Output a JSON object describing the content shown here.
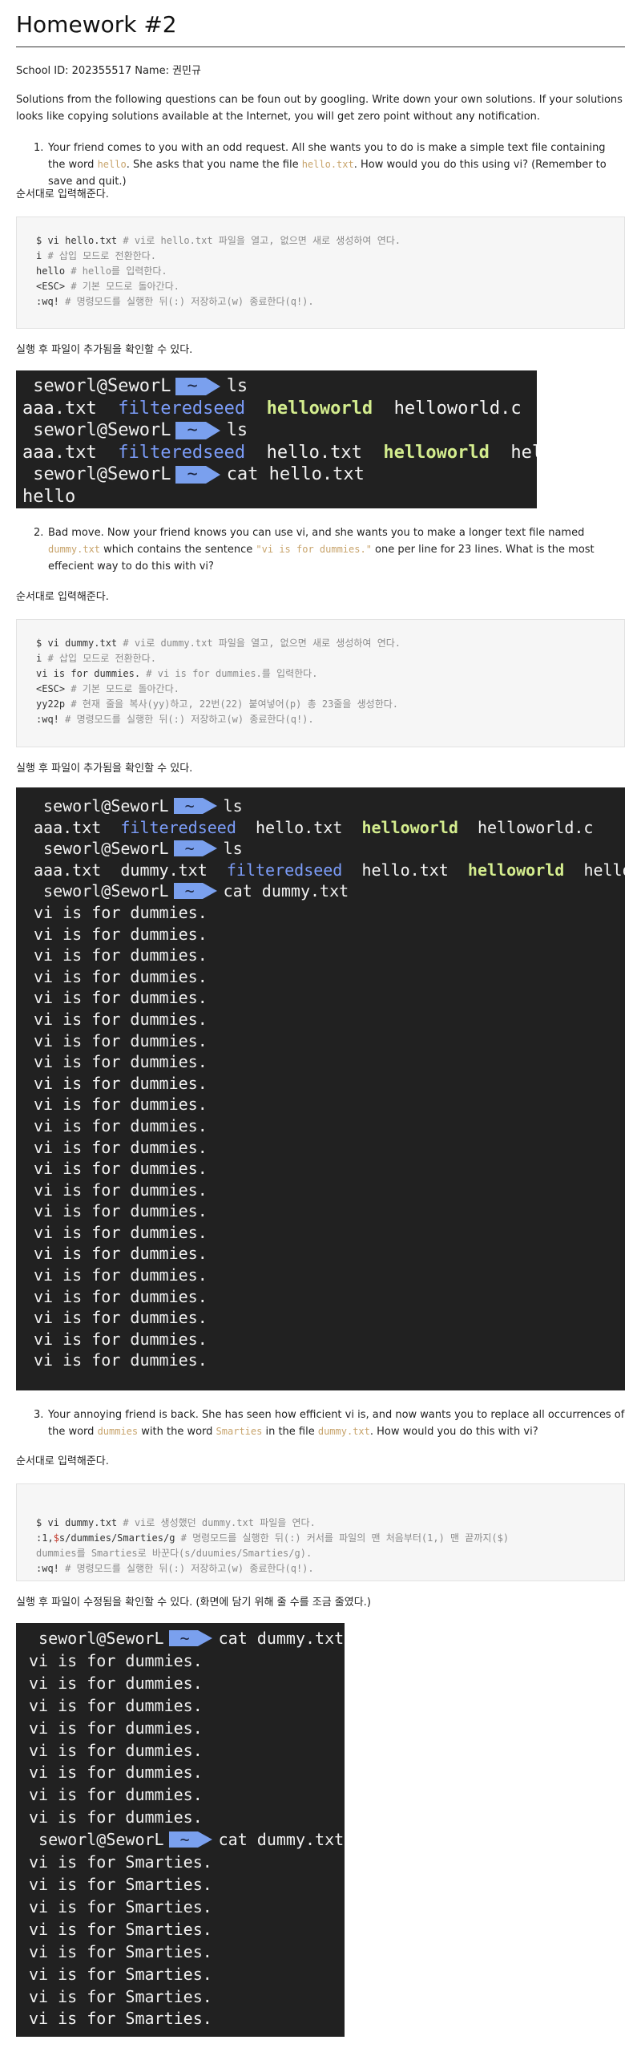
{
  "title": "Homework #2",
  "school_line": "School ID: 202355517 Name: 권민규",
  "intro": "Solutions from the following questions can be foun out by googling. Write down your own solutions. If your solutions looks like copying solutions available at the Internet, you will get zero point without any notification.",
  "q1": {
    "num": "1.",
    "a": "Your friend comes to you with an odd request. All she wants you to do is make a simple text file containing the word ",
    "code1": "hello",
    "b": ". She asks that you name the file ",
    "code2": "hello.txt",
    "c": ". How would you do this using vi? (Remember to save and quit.)"
  },
  "q1_note": "순서대로 입력해준다.",
  "q1_code": [
    {
      "cmd": "$ vi hello.txt ",
      "cm": "# vi로 hello.txt 파일을 열고, 없으면 새로 생성하여 연다."
    },
    {
      "cmd": "i ",
      "cm": "# 삽입 모드로 전환한다."
    },
    {
      "cmd": "hello ",
      "cm": "# hello를 입력한다."
    },
    {
      "cmd": "<ESC> ",
      "cm": "# 기본 모드로 돌아간다."
    },
    {
      "cmd": ":wq! ",
      "cm": "# 명령모드를 실행한 뒤(:) 저장하고(w) 종료한다(q!)."
    }
  ],
  "q1_after": "실행 후 파일이 추가됨을 확인할 수 있다.",
  "prompt": {
    "user": "seworl@SeworL",
    "dir": "~"
  },
  "term1": {
    "cmd_ls": "ls",
    "ls1": [
      "aaa.txt",
      "filteredseed",
      "helloworld",
      "helloworld.c"
    ],
    "ls2": [
      "aaa.txt",
      "filteredseed",
      "hello.txt",
      "helloworld",
      "helloworld.c"
    ],
    "cmd_cat": "cat hello.txt",
    "out": "hello"
  },
  "q2": {
    "num": "2.",
    "a": "Bad move. Now your friend knows you can use vi, and she wants you to make a longer text file named ",
    "code1": "dummy.txt",
    "b": " which contains the sentence ",
    "code2": "\"vi is for dummies.\"",
    "c": " one per line for 23 lines. What is the most effecient way to do this with vi?"
  },
  "q2_note": "순서대로 입력해준다.",
  "q2_code": [
    {
      "cmd": "$ vi dummy.txt ",
      "cm": "# vi로 dummy.txt 파일을 열고, 없으면 새로 생성하여 연다."
    },
    {
      "cmd": "i ",
      "cm": "# 삽입 모드로 전환한다."
    },
    {
      "cmd": "vi is for dummies. ",
      "cm": "# vi is for dummies.를 입력한다."
    },
    {
      "cmd": "<ESC> ",
      "cm": "# 기본 모드로 돌아간다."
    },
    {
      "cmd": "yy22p ",
      "cm": "# 현재 줄을 복사(yy)하고, 22번(22) 붙여넣어(p) 총 23줄을 생성한다."
    },
    {
      "cmd": ":wq! ",
      "cm": "# 명령모드를 실행한 뒤(:) 저장하고(w) 종료한다(q!)."
    }
  ],
  "q2_after": "실행 후 파일이 추가됨을 확인할 수 있다.",
  "term2": {
    "cmd_ls": "ls",
    "ls1": [
      "aaa.txt",
      "filteredseed",
      "hello.txt",
      "helloworld",
      "helloworld.c"
    ],
    "ls2": [
      "aaa.txt",
      "dummy.txt",
      "filteredseed",
      "hello.txt",
      "helloworld",
      "helloworld.c"
    ],
    "cmd_cat": "cat dummy.txt",
    "out_line": "vi is for dummies.",
    "out_count": 22
  },
  "q3": {
    "num": "3.",
    "a": "Your annoying friend is back. She has seen how efficient vi is, and now wants you to replace all occurrences of the word ",
    "code1": "dummies",
    "b": " with the word ",
    "code2": "Smarties",
    "c": " in the file ",
    "code3": "dummy.txt",
    "d": ". How would you do this with vi?"
  },
  "q3_note": "순서대로 입력해준다.",
  "q3_code": {
    "l1_cmd": "$ vi dummy.txt ",
    "l1_cm": "# vi로 생성했던 dummy.txt 파일을 연다.",
    "l2_a": ":1,",
    "l2_op": "$",
    "l2_b": "s/dummies/Smarties/g ",
    "l2_cm": "# 명령모드를 실행한 뒤(:) 커서를 파일의 맨 처음부터(1,) 맨 끝까지($)",
    "l3_cm": "dummies를 Smarties로 바꾼다(s/duumies/Smarties/g).",
    "l4_cmd": ":wq! ",
    "l4_cm": "# 명령모드를 실행한 뒤(:) 저장하고(w) 종료한다(q!)."
  },
  "q3_after": "실행 후 파일이 수정됨을 확인할 수 있다. (화면에 담기 위해 줄 수를 조금 줄였다.)",
  "term3": {
    "cmd_cat": "cat dummy.txt",
    "out1_line": "vi is for dummies.",
    "out1_count": 8,
    "out2_line": "vi is for Smarties.",
    "out2_count": 8
  }
}
